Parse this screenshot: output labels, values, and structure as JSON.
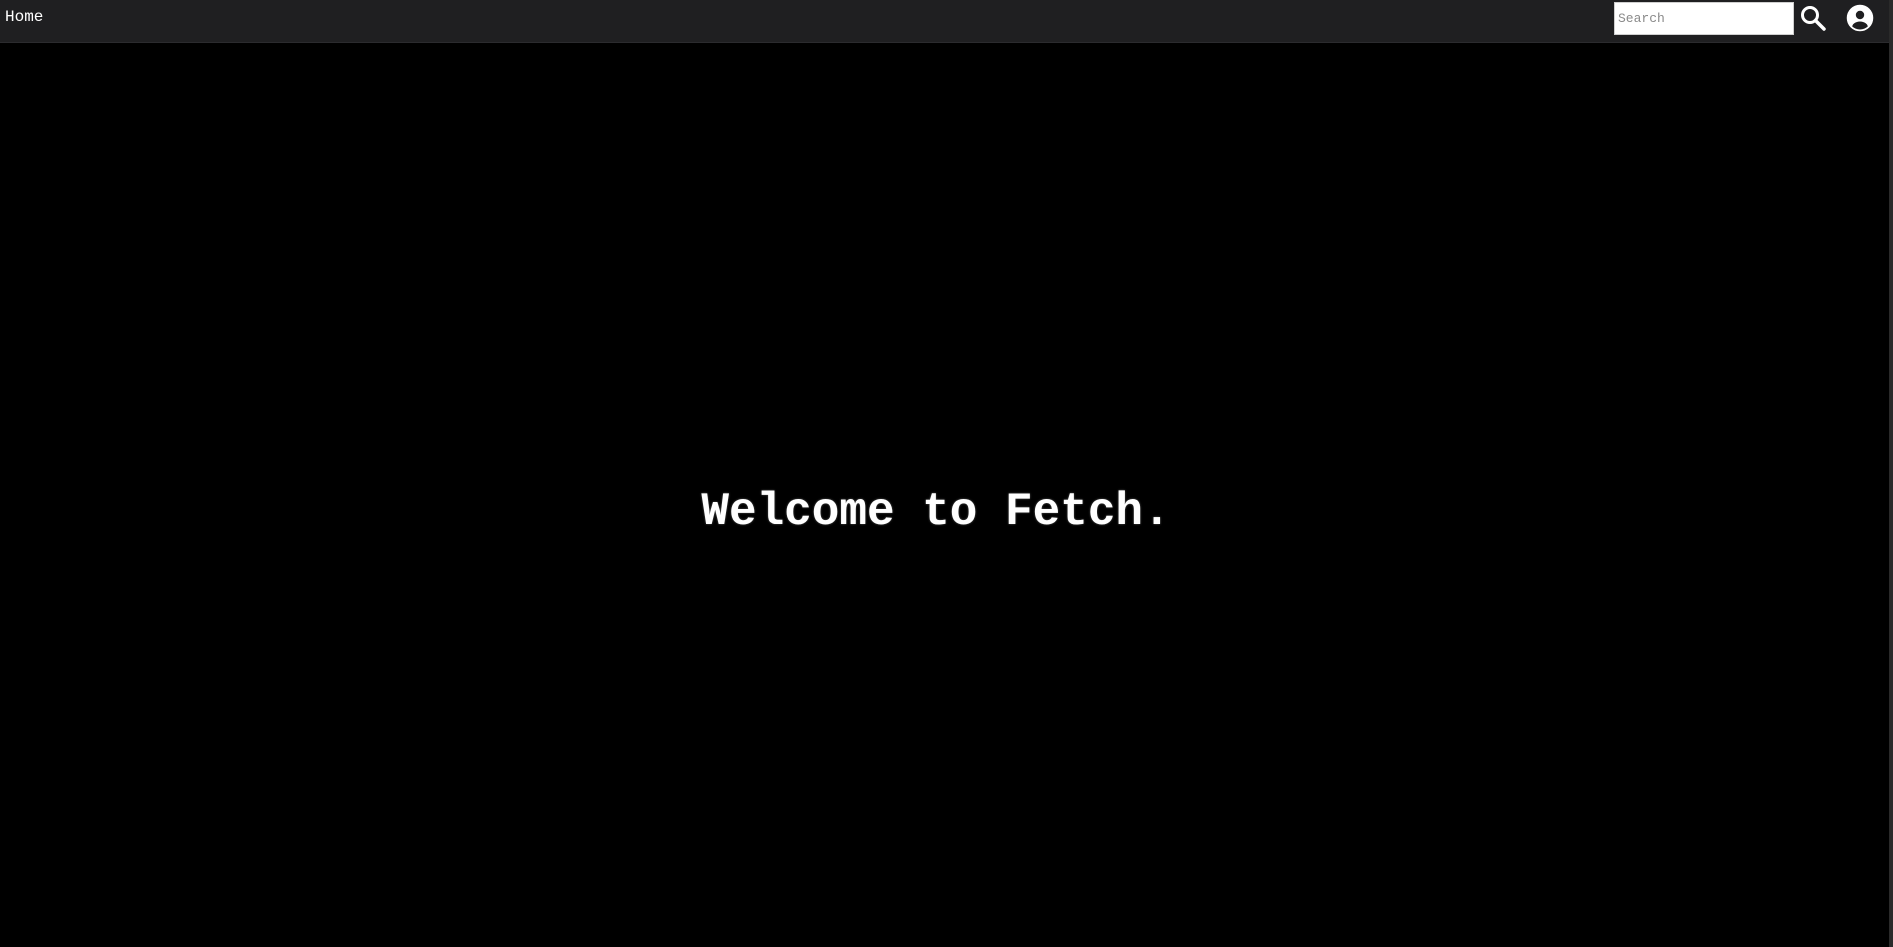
{
  "nav": {
    "home_label": "Home",
    "search_placeholder": "Search",
    "search_value": "",
    "search_icon": "search-icon",
    "account_icon": "user-circle-icon"
  },
  "main": {
    "welcome_text": "Welcome to Fetch."
  },
  "colors": {
    "background": "#000000",
    "topbar": "#1f1f21",
    "text": "#ffffff"
  }
}
